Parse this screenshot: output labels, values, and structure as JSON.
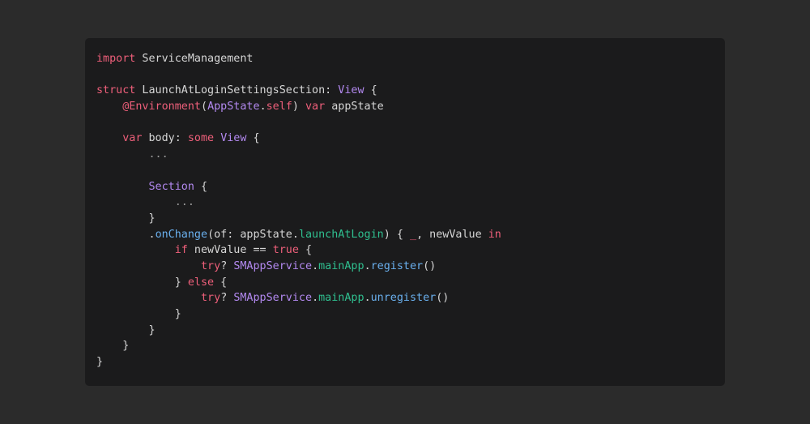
{
  "code": {
    "lines": [
      [
        {
          "t": "import",
          "k": "keyword"
        },
        {
          "t": " ServiceManagement",
          "k": "plain"
        }
      ],
      [],
      [
        {
          "t": "struct",
          "k": "keyword"
        },
        {
          "t": " LaunchAtLoginSettingsSection: ",
          "k": "plain"
        },
        {
          "t": "View",
          "k": "type"
        },
        {
          "t": " {",
          "k": "plain"
        }
      ],
      [
        {
          "t": "    ",
          "k": "plain"
        },
        {
          "t": "@Environment",
          "k": "keyword"
        },
        {
          "t": "(",
          "k": "plain"
        },
        {
          "t": "AppState",
          "k": "type"
        },
        {
          "t": ".",
          "k": "plain"
        },
        {
          "t": "self",
          "k": "keyword"
        },
        {
          "t": ") ",
          "k": "plain"
        },
        {
          "t": "var",
          "k": "keyword"
        },
        {
          "t": " appState",
          "k": "plain"
        }
      ],
      [],
      [
        {
          "t": "    ",
          "k": "plain"
        },
        {
          "t": "var",
          "k": "keyword"
        },
        {
          "t": " body: ",
          "k": "plain"
        },
        {
          "t": "some",
          "k": "keyword"
        },
        {
          "t": " ",
          "k": "plain"
        },
        {
          "t": "View",
          "k": "type"
        },
        {
          "t": " {",
          "k": "plain"
        }
      ],
      [
        {
          "t": "        ...",
          "k": "muted"
        }
      ],
      [],
      [
        {
          "t": "        ",
          "k": "plain"
        },
        {
          "t": "Section",
          "k": "type"
        },
        {
          "t": " {",
          "k": "plain"
        }
      ],
      [
        {
          "t": "            ...",
          "k": "muted"
        }
      ],
      [
        {
          "t": "        }",
          "k": "plain"
        }
      ],
      [
        {
          "t": "        .",
          "k": "plain"
        },
        {
          "t": "onChange",
          "k": "func"
        },
        {
          "t": "(of: appState.",
          "k": "plain"
        },
        {
          "t": "launchAtLogin",
          "k": "prop"
        },
        {
          "t": ") { ",
          "k": "plain"
        },
        {
          "t": "_",
          "k": "keyword"
        },
        {
          "t": ", newValue ",
          "k": "plain"
        },
        {
          "t": "in",
          "k": "keyword"
        }
      ],
      [
        {
          "t": "            ",
          "k": "plain"
        },
        {
          "t": "if",
          "k": "keyword"
        },
        {
          "t": " newValue == ",
          "k": "plain"
        },
        {
          "t": "true",
          "k": "keyword"
        },
        {
          "t": " {",
          "k": "plain"
        }
      ],
      [
        {
          "t": "                ",
          "k": "plain"
        },
        {
          "t": "try",
          "k": "keyword"
        },
        {
          "t": "? ",
          "k": "plain"
        },
        {
          "t": "SMAppService",
          "k": "type"
        },
        {
          "t": ".",
          "k": "plain"
        },
        {
          "t": "mainApp",
          "k": "prop"
        },
        {
          "t": ".",
          "k": "plain"
        },
        {
          "t": "register",
          "k": "func"
        },
        {
          "t": "()",
          "k": "plain"
        }
      ],
      [
        {
          "t": "            } ",
          "k": "plain"
        },
        {
          "t": "else",
          "k": "keyword"
        },
        {
          "t": " {",
          "k": "plain"
        }
      ],
      [
        {
          "t": "                ",
          "k": "plain"
        },
        {
          "t": "try",
          "k": "keyword"
        },
        {
          "t": "? ",
          "k": "plain"
        },
        {
          "t": "SMAppService",
          "k": "type"
        },
        {
          "t": ".",
          "k": "plain"
        },
        {
          "t": "mainApp",
          "k": "prop"
        },
        {
          "t": ".",
          "k": "plain"
        },
        {
          "t": "unregister",
          "k": "func"
        },
        {
          "t": "()",
          "k": "plain"
        }
      ],
      [
        {
          "t": "            }",
          "k": "plain"
        }
      ],
      [
        {
          "t": "        }",
          "k": "plain"
        }
      ],
      [
        {
          "t": "    }",
          "k": "plain"
        }
      ],
      [
        {
          "t": "}",
          "k": "plain"
        }
      ]
    ]
  },
  "colors": {
    "page_background": "#2b2b2b",
    "card_background": "#1b1b1c",
    "plain": "#d6d6d6",
    "keyword": "#ee5f7a",
    "type": "#b389f0",
    "function": "#6ab0ee",
    "property": "#2fbf8f"
  }
}
